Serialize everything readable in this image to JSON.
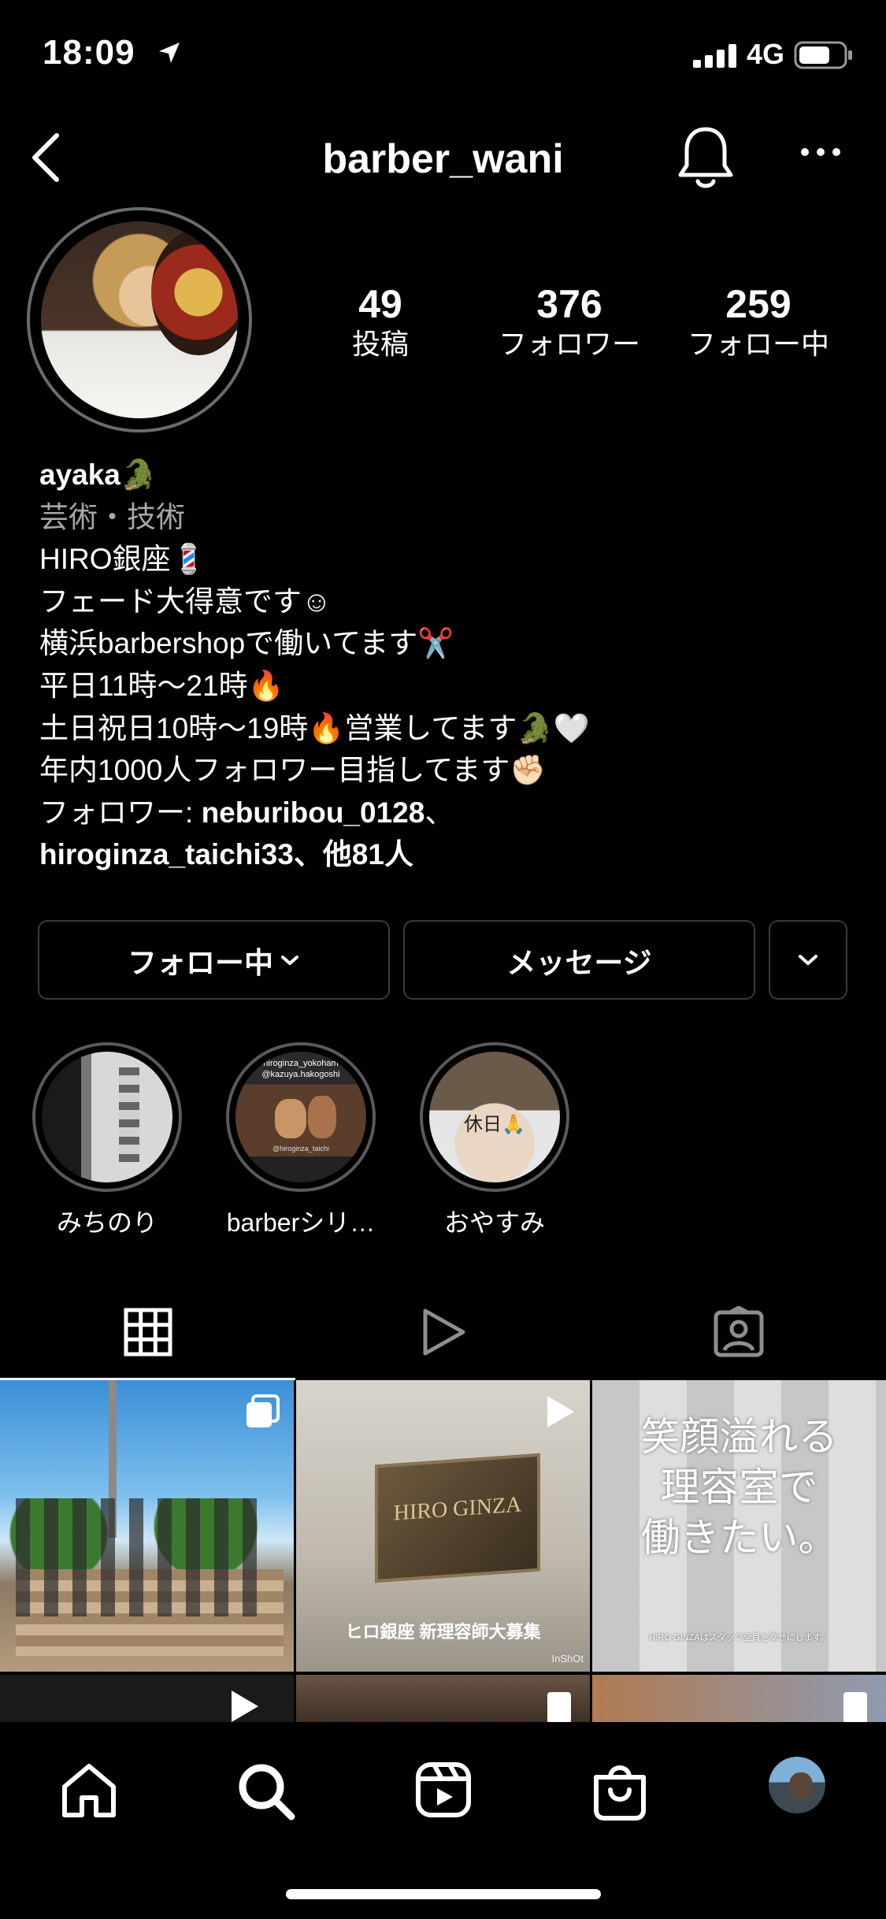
{
  "status": {
    "time": "18:09",
    "network": "4G"
  },
  "header": {
    "username": "barber_wani"
  },
  "stats": [
    {
      "value": "49",
      "label": "投稿"
    },
    {
      "value": "376",
      "label": "フォロワー"
    },
    {
      "value": "259",
      "label": "フォロー中"
    }
  ],
  "bio": {
    "name": "ayaka🐊",
    "category": "芸術・技術",
    "lines": [
      "HIRO銀座💈",
      "フェード大得意です☺︎",
      "横浜barbershopで働いてます✂️",
      "平日11時〜21時🔥",
      "土日祝日10時〜19時🔥営業してます🐊🤍",
      "年内1000人フォロワー目指してます✊🏻"
    ],
    "followed_by_prefix": "フォロワー: ",
    "followed_by_user1": "neburibou_0128",
    "followed_by_sep": "、",
    "followed_by_user2": "hiroginza_taichi33",
    "followed_by_suffix": "、他81人"
  },
  "buttons": {
    "following": "フォロー中",
    "message": "メッセージ"
  },
  "highlights": [
    {
      "label": "みちのり"
    },
    {
      "label": "barberシリ…"
    },
    {
      "label": "おやすみ",
      "overlay": "休日🙏"
    }
  ],
  "highlight_texts": {
    "hl2_line1": "hiroginza_yokoham",
    "hl2_line2": "@kazuya.hakogoshi",
    "hl2_line3": "@hiroginza_taichi"
  },
  "posts": {
    "p2_sign": "HIRO GINZA",
    "p2_caption": "ヒロ銀座 新理容師大募集",
    "p2_watermark": "InShOt",
    "p3_line1": "笑顔溢れる",
    "p3_line2": "理容室で",
    "p3_line3": "働きたい。",
    "p3_footer": "HIRO GINZAはスタッフ全員を幸せにします。"
  },
  "icons": {
    "back": "back-chevron-icon",
    "bell": "bell-icon",
    "more": "more-icon",
    "grid": "grid-icon",
    "reels": "reels-icon",
    "tagged": "tagged-icon",
    "home": "home-icon",
    "search": "search-icon",
    "reels_nav": "reels-nav-icon",
    "shop": "shop-icon"
  }
}
